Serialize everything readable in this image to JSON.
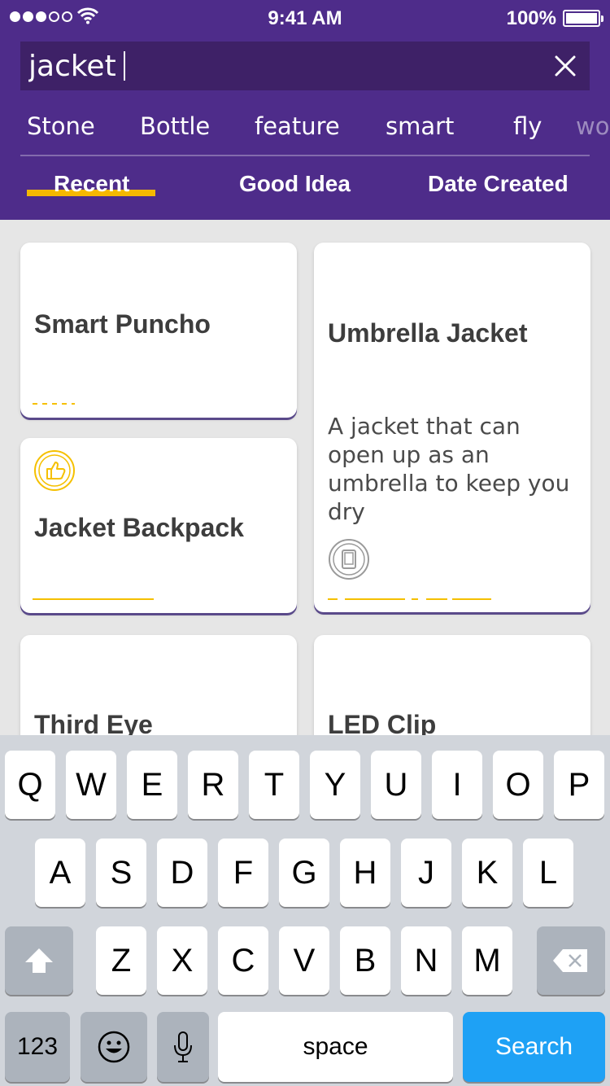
{
  "status_bar": {
    "time": "9:41 AM",
    "battery": "100%"
  },
  "search": {
    "value": "jacket",
    "placeholder": ""
  },
  "chips": [
    "Stone",
    "Bottle",
    "feature",
    "smart",
    "fly",
    "wo"
  ],
  "tabs": [
    "Recent",
    "Good Idea",
    "Date Created"
  ],
  "cards": [
    {
      "title": "Smart Puncho"
    },
    {
      "title": "Umbrella Jacket",
      "description": "A jacket that can open up as an umbrella to keep you dry"
    },
    {
      "title": "Jacket Backpack"
    },
    {
      "title": "Third Eye"
    },
    {
      "title": "LED Clip"
    }
  ],
  "keyboard": {
    "row1": [
      "Q",
      "W",
      "E",
      "R",
      "T",
      "Y",
      "U",
      "I",
      "O",
      "P"
    ],
    "row2": [
      "A",
      "S",
      "D",
      "F",
      "G",
      "H",
      "J",
      "K",
      "L"
    ],
    "row3": [
      "Z",
      "X",
      "C",
      "V",
      "B",
      "N",
      "M"
    ],
    "numbers": "123",
    "space": "space",
    "search": "Search"
  },
  "colors": {
    "header": "#4e2c8a",
    "search_bg": "#3e2167",
    "accent": "#f5b800",
    "search_key": "#1ea1f5"
  }
}
